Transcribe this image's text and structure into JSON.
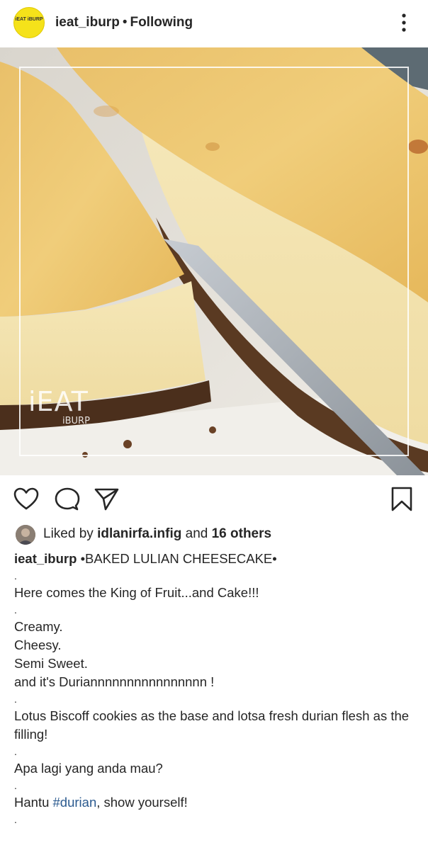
{
  "post": {
    "username": "ieat_iburp",
    "follow_status": "Following",
    "separator": "•",
    "avatar_text": "iEAT iBURP"
  },
  "photo": {
    "watermark_main": "iEAT",
    "watermark_sub": "iBURP"
  },
  "likes": {
    "prefix": "Liked by",
    "liker": "idlanirfa.infig",
    "middle": "and",
    "others": "16 others"
  },
  "caption": {
    "username": "ieat_iburp",
    "title": "•BAKED LULIAN CHEESECAKE•",
    "dot1": ".",
    "line1": "Here comes the King of Fruit...and Cake!!!",
    "dot2": ".",
    "line2": "Creamy.",
    "line3": "Cheesy.",
    "line4": "Semi Sweet.",
    "line5": "and it's Duriannnnnnnnnnnnnnnn !",
    "dot3": ".",
    "line6": "Lotus Biscoff cookies as the base and lotsa fresh durian flesh as the filling!",
    "dot4": ".",
    "line7": "Apa lagi yang anda mau?",
    "dot5": ".",
    "line8_prefix": "Hantu",
    "hashtag": "#durian",
    "line8_suffix": ", show yourself!",
    "dot6": "."
  },
  "icons": {
    "more": "vertical-ellipsis-icon",
    "like": "heart-icon",
    "comment": "comment-bubble-icon",
    "share": "paper-plane-icon",
    "save": "bookmark-icon"
  },
  "colors": {
    "text": "#262626",
    "hashtag": "#2b5a8f",
    "avatar_bg": "#f5e21a"
  }
}
